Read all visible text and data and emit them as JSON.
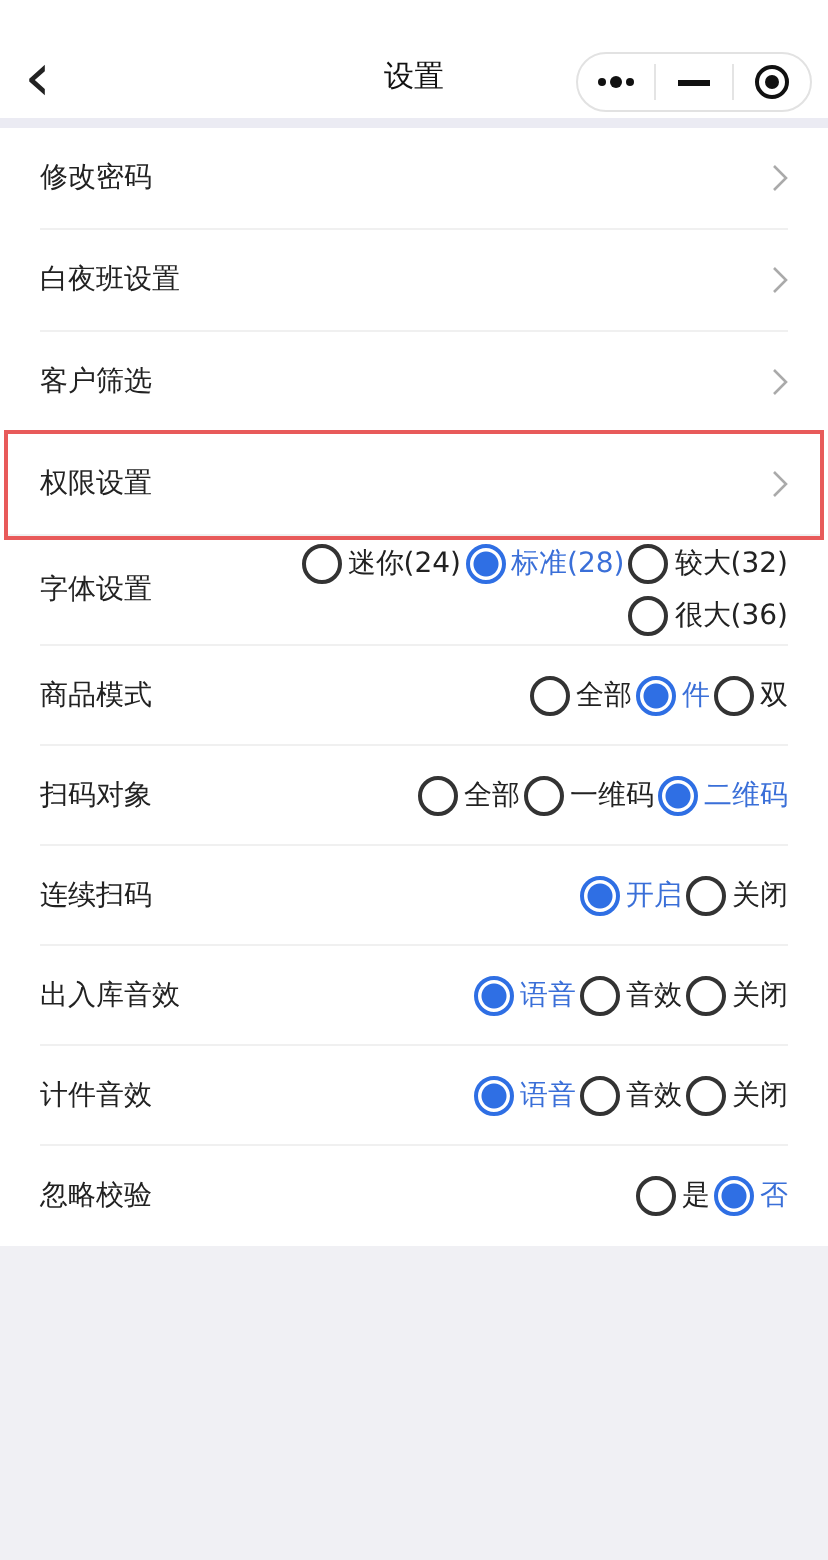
{
  "header": {
    "back": "‹",
    "title": "设置"
  },
  "links": [
    {
      "label": "修改密码",
      "highlighted": false
    },
    {
      "label": "白夜班设置",
      "highlighted": false
    },
    {
      "label": "客户筛选",
      "highlighted": false
    },
    {
      "label": "权限设置",
      "highlighted": true
    }
  ],
  "settings": [
    {
      "label": "字体设置",
      "options": [
        {
          "label": "迷你(24)",
          "selected": false
        },
        {
          "label": "标准(28)",
          "selected": true
        },
        {
          "label": "较大(32)",
          "selected": false
        },
        {
          "label": "很大(36)",
          "selected": false
        }
      ]
    },
    {
      "label": "商品模式",
      "options": [
        {
          "label": "全部",
          "selected": false
        },
        {
          "label": "件",
          "selected": true
        },
        {
          "label": "双",
          "selected": false
        }
      ]
    },
    {
      "label": "扫码对象",
      "options": [
        {
          "label": "全部",
          "selected": false
        },
        {
          "label": "一维码",
          "selected": false
        },
        {
          "label": "二维码",
          "selected": true
        }
      ]
    },
    {
      "label": "连续扫码",
      "options": [
        {
          "label": "开启",
          "selected": true
        },
        {
          "label": "关闭",
          "selected": false
        }
      ]
    },
    {
      "label": "出入库音效",
      "options": [
        {
          "label": "语音",
          "selected": true
        },
        {
          "label": "音效",
          "selected": false
        },
        {
          "label": "关闭",
          "selected": false
        }
      ]
    },
    {
      "label": "计件音效",
      "options": [
        {
          "label": "语音",
          "selected": true
        },
        {
          "label": "音效",
          "selected": false
        },
        {
          "label": "关闭",
          "selected": false
        }
      ]
    },
    {
      "label": "忽略校验",
      "options": [
        {
          "label": "是",
          "selected": false
        },
        {
          "label": "否",
          "selected": true
        }
      ]
    }
  ]
}
